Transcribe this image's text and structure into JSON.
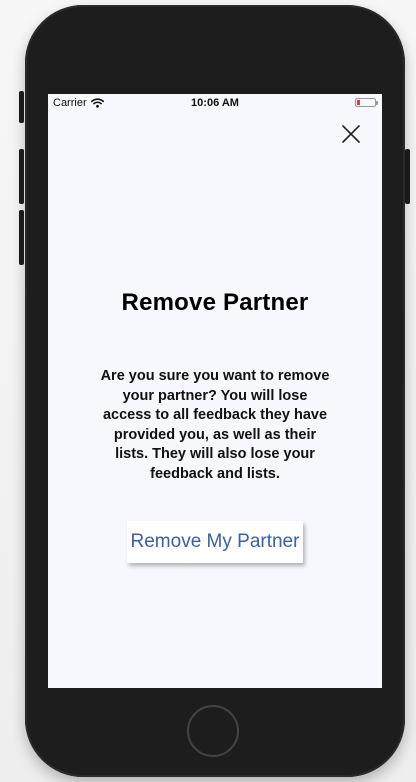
{
  "status_bar": {
    "carrier": "Carrier",
    "time": "10:06 AM",
    "wifi_icon": "wifi-icon",
    "battery_icon": "battery-low-icon",
    "battery_color": "#e0403a"
  },
  "dialog": {
    "close_icon": "close-icon",
    "title": "Remove Partner",
    "message": "Are you sure you want to remove your partner? You will lose access to all feedback they have provided you, as well as their lists. They will also lose your feedback and lists.",
    "confirm_label": "Remove My Partner",
    "confirm_color": "#3a5fa8"
  },
  "device": {
    "home_button_icon": "home-button"
  }
}
